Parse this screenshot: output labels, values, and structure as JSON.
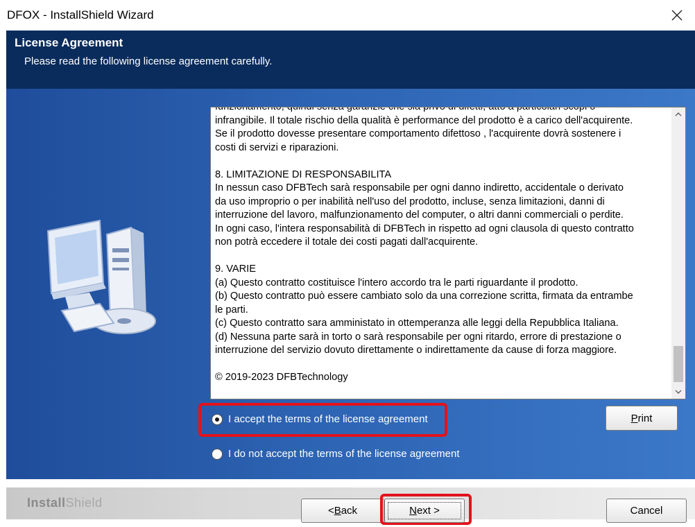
{
  "window": {
    "title": "DFOX - InstallShield Wizard",
    "close_icon": "close-icon"
  },
  "header": {
    "title": "License Agreement",
    "subtitle": "Please read the following license agreement carefully."
  },
  "license": {
    "lines": [
      "funzionamento, quindi senza garanzie che sia privo di difetti, atto a particolari scopi o",
      "infrangibile. Il totale rischio della qualità è performance del prodotto è a carico dell'acquirente.",
      "Se il prodotto dovesse presentare comportamento difettoso , l'acquirente dovrà sostenere i",
      "costi di servizi e riparazioni.",
      "",
      "8. LIMITAZIONE DI RESPONSABILITA",
      "In nessun caso DFBTech sarà responsabile per ogni danno indiretto, accidentale o derivato",
      "da uso improprio o per inabilità nell'uso del prodotto, incluse, senza limitazioni, danni di",
      "interruzione del lavoro, malfunzionamento del computer, o altri danni commerciali o perdite.",
      "In ogni caso, l'intera responsabilità di DFBTech in rispetto ad ogni clausola di questo contratto",
      "non potrà eccedere il totale  dei costi pagati dall'acquirente.",
      "",
      "9. VARIE",
      "(a) Questo contratto costituisce l'intero accordo tra le parti riguardante il prodotto.",
      "(b) Questo contratto può essere cambiato solo da una correzione scritta, firmata da entrambe",
      "le parti.",
      "(c) Questo contratto sara amministato in ottemperanza alle leggi della Repubblica Italiana.",
      "(d) Nessuna parte sarà in torto o sarà responsabile per ogni ritardo, errore di  prestazione o",
      "interruzione del servizio dovuto direttamente o indirettamente da cause di forza maggiore.",
      "",
      "© 2019-2023 DFBTechnology"
    ],
    "scroll_position": 0.92
  },
  "options": {
    "accept": {
      "label": "I accept the terms of the license agreement",
      "selected": true
    },
    "decline": {
      "label": "I do not accept the terms of the license agreement",
      "selected": false
    }
  },
  "buttons": {
    "print_pre": "",
    "print_mnemonic": "P",
    "print_post": "rint",
    "back_pre": "< ",
    "back_mnemonic": "B",
    "back_post": "ack",
    "next_pre": "",
    "next_mnemonic": "N",
    "next_post": "ext >",
    "cancel": "Cancel"
  },
  "footer": {
    "brand_a": "Install",
    "brand_b": "Shield"
  },
  "colors": {
    "header": "#0a2c5c",
    "body": "#2d64b3",
    "highlight": "#e3121c"
  }
}
